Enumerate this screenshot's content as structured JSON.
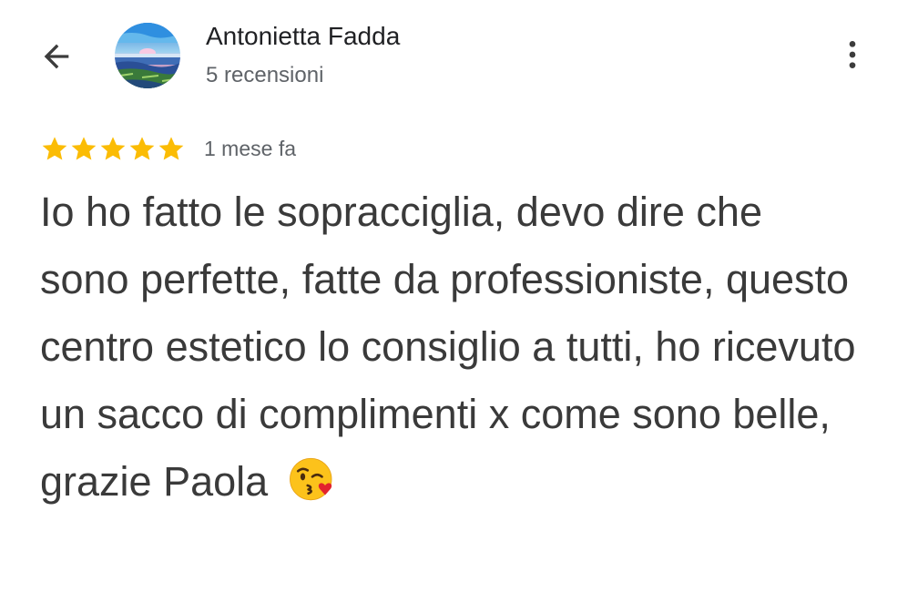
{
  "header": {
    "author_name": "Antonietta Fadda",
    "review_count": "5 recensioni",
    "back_icon": "arrow-back-icon",
    "more_icon": "more-vert-icon"
  },
  "review": {
    "rating": 5,
    "rating_max": 5,
    "date": "1 mese fa",
    "text": "Io ho fatto le sopracciglia, devo dire che sono perfette, fatte da professioniste, questo centro estetico lo consiglio a tutti, ho ricevuto un sacco di complimenti x come sono belle, grazie Paola",
    "emoji": "face-blowing-a-kiss"
  },
  "colors": {
    "star": "#fbbc04",
    "text": "#3a3a3a",
    "secondary_text": "#5f6368"
  }
}
